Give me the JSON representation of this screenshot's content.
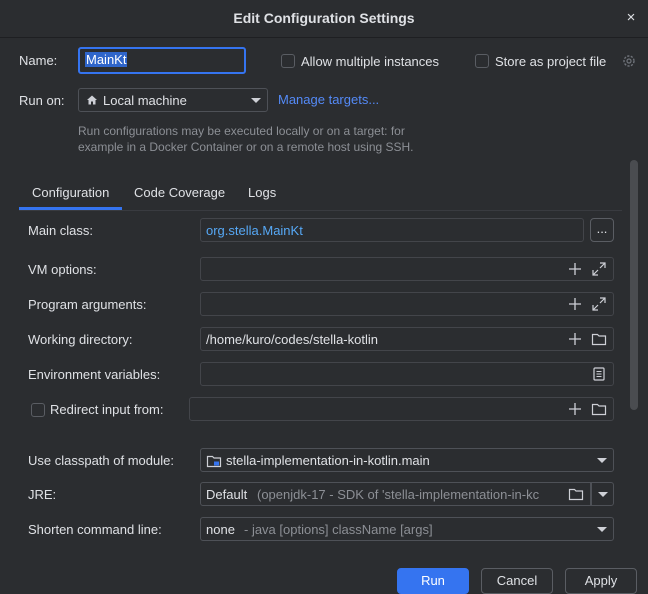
{
  "window": {
    "title": "Edit Configuration Settings",
    "close_glyph": "×"
  },
  "name": {
    "label": "Name:",
    "value": "MainKt"
  },
  "options": {
    "allow_multiple": {
      "label": "Allow multiple instances",
      "checked": false
    },
    "store_project": {
      "label": "Store as project file",
      "checked": false
    }
  },
  "run_on": {
    "label": "Run on:",
    "value": "Local machine",
    "manage_link": "Manage targets...",
    "hint_line1": "Run configurations may be executed locally or on a target: for",
    "hint_line2": "example in a Docker Container or on a remote host using SSH."
  },
  "tabs": [
    {
      "label": "Configuration",
      "active": true
    },
    {
      "label": "Code Coverage",
      "active": false
    },
    {
      "label": "Logs",
      "active": false
    }
  ],
  "fields": {
    "main_class": {
      "label": "Main class:",
      "value": "org.stella.MainKt",
      "browse": "..."
    },
    "vm_options": {
      "label": "VM options:",
      "value": ""
    },
    "program_args": {
      "label": "Program arguments:",
      "value": ""
    },
    "working_dir": {
      "label": "Working directory:",
      "value": "/home/kuro/codes/stella-kotlin"
    },
    "env_vars": {
      "label": "Environment variables:",
      "value": ""
    },
    "redirect_input": {
      "label": "Redirect input from:",
      "value": "",
      "checked": false
    },
    "classpath_module": {
      "label": "Use classpath of module:",
      "value": "stella-implementation-in-kotlin.main"
    },
    "jre": {
      "label": "JRE:",
      "value": "Default",
      "detail": "(openjdk-17 - SDK of 'stella-implementation-in-kc"
    },
    "shorten_cmd": {
      "label": "Shorten command line:",
      "value": "none",
      "detail": "- java [options] className [args]"
    }
  },
  "buttons": {
    "run": "Run",
    "cancel": "Cancel",
    "apply": "Apply"
  },
  "colors": {
    "accent": "#3574f0",
    "link": "#548af7",
    "background": "#2b2d30",
    "main_class_text": "#56a8f5"
  }
}
